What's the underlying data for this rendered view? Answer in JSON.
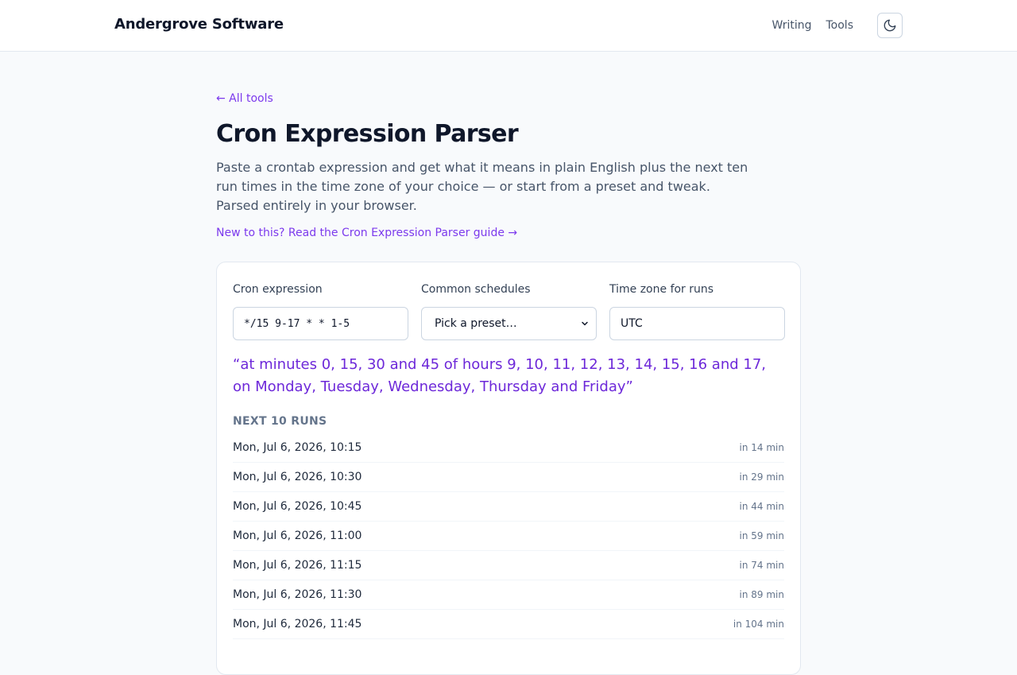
{
  "header": {
    "brand": "Andergrove Software",
    "nav": [
      "Writing",
      "Tools"
    ],
    "theme_icon": "moon-icon"
  },
  "page": {
    "back_link": "← All tools",
    "title": "Cron Expression Parser",
    "intro": "Paste a crontab expression and get what it means in plain English plus the next ten run times in the time zone of your choice — or start from a preset and tweak. Parsed entirely in your browser.",
    "guide_link": "New to this? Read the Cron Expression Parser guide →"
  },
  "form": {
    "cron_label": "Cron expression",
    "cron_value": "*/15 9-17 * * 1-5",
    "preset_label": "Common schedules",
    "preset_value": "Pick a preset…",
    "tz_label": "Time zone for runs",
    "tz_value": "UTC"
  },
  "description": "“at minutes 0, 15, 30 and 45 of hours 9, 10, 11, 12, 13, 14, 15, 16 and 17, on Monday, Tuesday, Wednesday, Thursday and Friday”",
  "runs": {
    "heading": "NEXT 10 RUNS",
    "items": [
      {
        "date": "Mon, Jul 6, 2026, 10:15",
        "rel": "in 14 min"
      },
      {
        "date": "Mon, Jul 6, 2026, 10:30",
        "rel": "in 29 min"
      },
      {
        "date": "Mon, Jul 6, 2026, 10:45",
        "rel": "in 44 min"
      },
      {
        "date": "Mon, Jul 6, 2026, 11:00",
        "rel": "in 59 min"
      },
      {
        "date": "Mon, Jul 6, 2026, 11:15",
        "rel": "in 74 min"
      },
      {
        "date": "Mon, Jul 6, 2026, 11:30",
        "rel": "in 89 min"
      },
      {
        "date": "Mon, Jul 6, 2026, 11:45",
        "rel": "in 104 min"
      }
    ]
  }
}
